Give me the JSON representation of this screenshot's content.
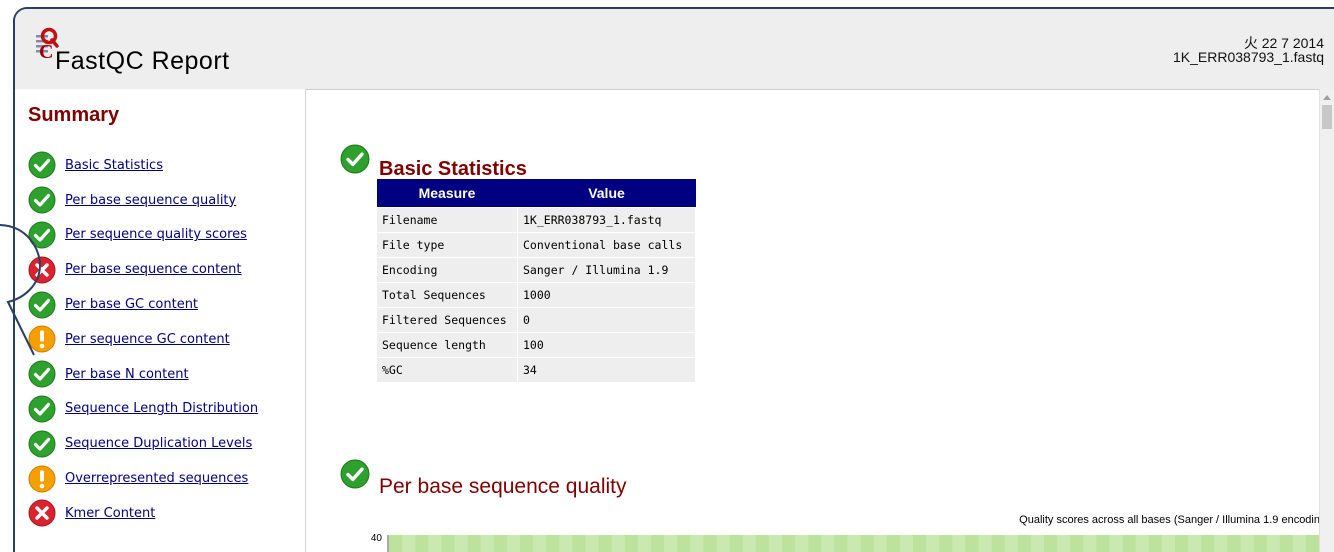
{
  "header": {
    "title": "FastQC Report",
    "date": "火 22 7 2014",
    "filename": "1K_ERR038793_1.fastq"
  },
  "summary": {
    "heading": "Summary",
    "items": [
      {
        "label": "Basic Statistics",
        "status": "pass"
      },
      {
        "label": "Per base sequence quality",
        "status": "pass"
      },
      {
        "label": "Per sequence quality scores",
        "status": "pass"
      },
      {
        "label": "Per base sequence content",
        "status": "fail"
      },
      {
        "label": "Per base GC content",
        "status": "pass"
      },
      {
        "label": "Per sequence GC content",
        "status": "warn"
      },
      {
        "label": "Per base N content",
        "status": "pass"
      },
      {
        "label": "Sequence Length Distribution",
        "status": "pass"
      },
      {
        "label": "Sequence Duplication Levels",
        "status": "pass"
      },
      {
        "label": "Overrepresented sequences",
        "status": "warn"
      },
      {
        "label": "Kmer Content",
        "status": "fail"
      }
    ]
  },
  "basic_stats": {
    "heading": "Basic Statistics",
    "columns": [
      "Measure",
      "Value"
    ],
    "rows": [
      [
        "Filename",
        "1K_ERR038793_1.fastq"
      ],
      [
        "File type",
        "Conventional base calls"
      ],
      [
        "Encoding",
        "Sanger / Illumina 1.9"
      ],
      [
        "Total Sequences",
        "1000"
      ],
      [
        "Filtered Sequences",
        "0"
      ],
      [
        "Sequence length",
        "100"
      ],
      [
        "%GC",
        "34"
      ]
    ]
  },
  "per_base_quality": {
    "heading": "Per base sequence quality",
    "caption": "Quality scores across all bases (Sanger / Illumina 1.9 encodin",
    "y_tick_top": "40"
  },
  "colors": {
    "pass": "#2ea02e",
    "warn": "#f5a000",
    "fail": "#d9232e",
    "heading": "#800000",
    "link": "#000080",
    "table_header": "#000080"
  }
}
